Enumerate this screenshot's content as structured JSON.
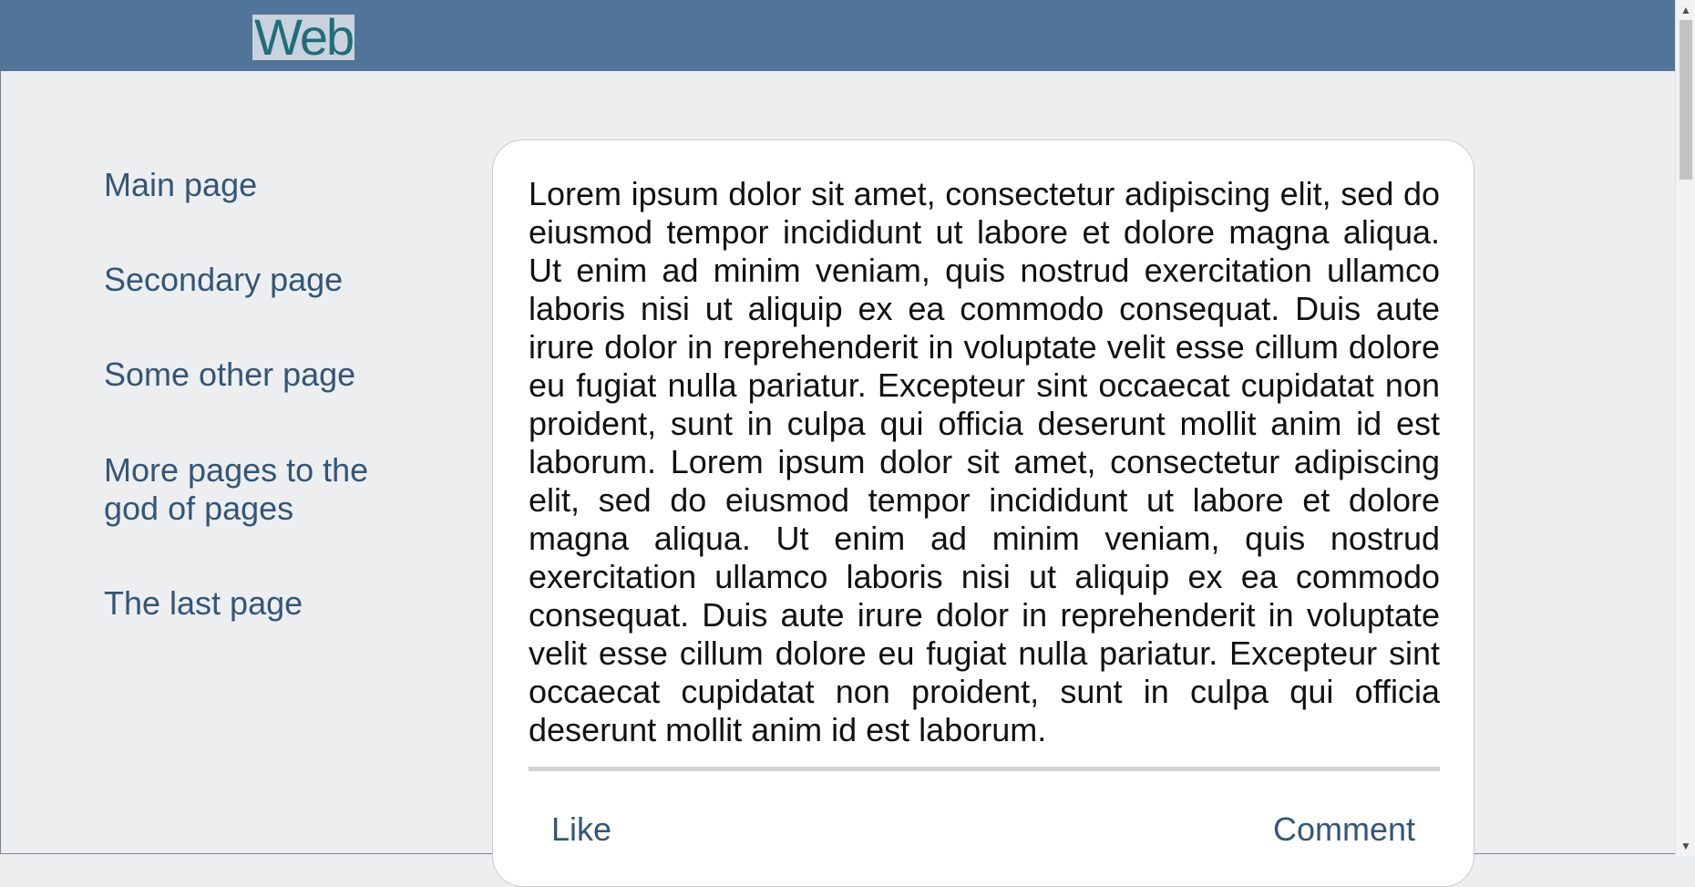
{
  "header": {
    "logo_text": "Web",
    "colors": {
      "bar": "#517499",
      "logo_background": "#c9d2de",
      "logo_text": "#1f6e78"
    }
  },
  "sidebar": {
    "items": [
      {
        "label": "Main page"
      },
      {
        "label": "Secondary page"
      },
      {
        "label": "Some other page"
      },
      {
        "label": "More pages to the god of pages"
      },
      {
        "label": "The last page"
      }
    ],
    "link_color": "#345677"
  },
  "post": {
    "body": "Lorem ipsum dolor sit amet, consectetur adipiscing elit, sed do eiusmod tempor incididunt ut labore et dolore magna aliqua. Ut enim ad minim veniam, quis nostrud exercitation ullamco laboris nisi ut aliquip ex ea commodo consequat. Duis aute irure dolor in reprehenderit in voluptate velit esse cillum dolore eu fugiat nulla pariatur. Excepteur sint occaecat cupidatat non proident, sunt in culpa qui officia deserunt mollit anim id est laborum. Lorem ipsum dolor sit amet, consectetur adipiscing elit, sed do eiusmod tempor incididunt ut labore et dolore magna aliqua. Ut enim ad minim veniam, quis nostrud exercitation ullamco laboris nisi ut aliquip ex ea commodo consequat. Duis aute irure dolor in reprehenderit in voluptate velit esse cillum dolore eu fugiat nulla pariatur. Excepteur sint occaecat cupidatat non proident, sunt in culpa qui officia deserunt mollit anim id est laborum.",
    "like_label": "Like",
    "comment_label": "Comment"
  },
  "page_background": "#eceef0"
}
